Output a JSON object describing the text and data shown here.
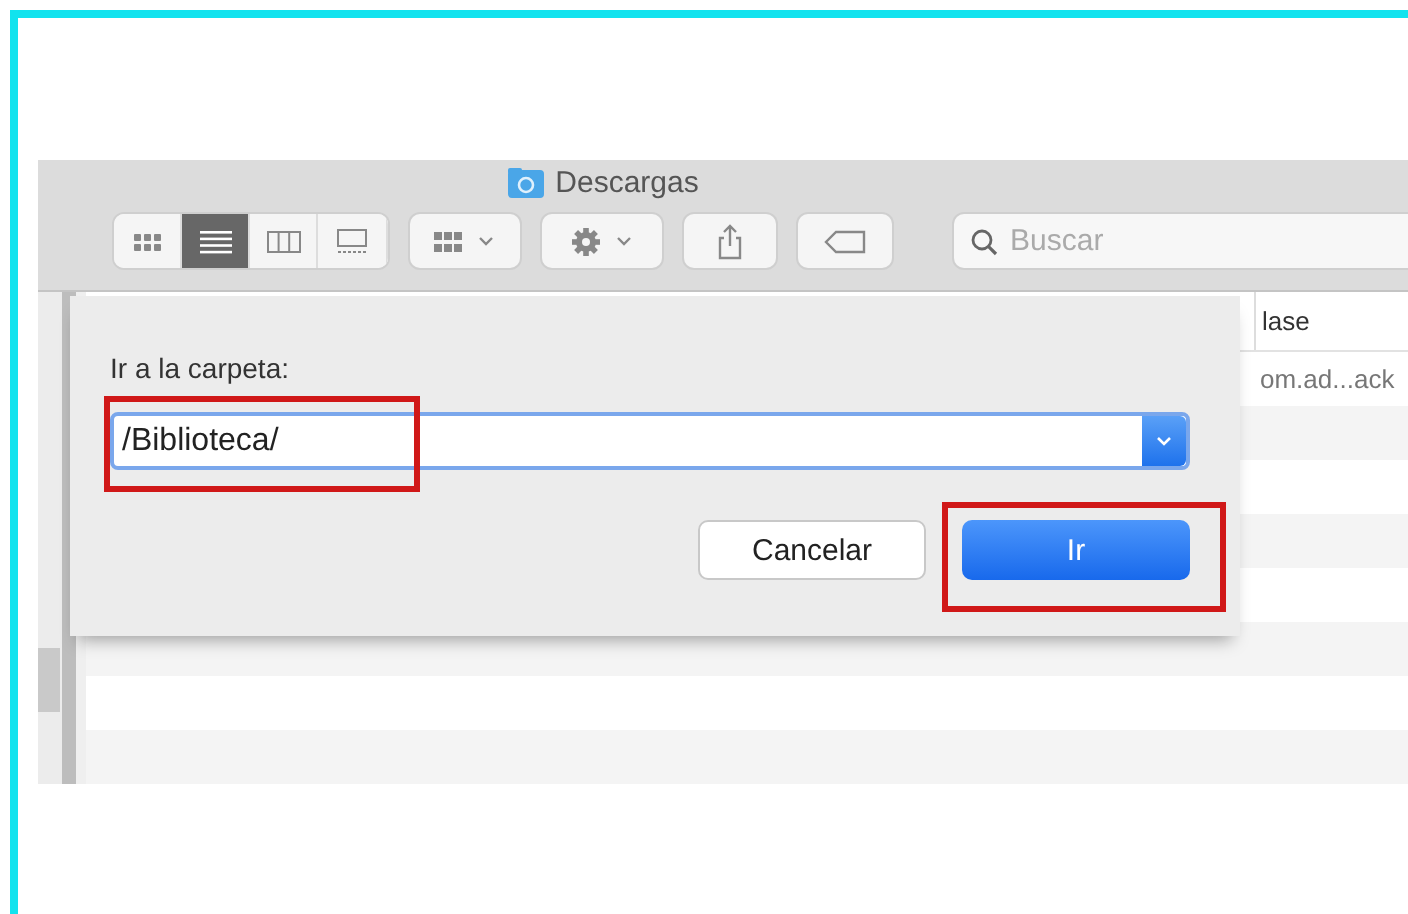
{
  "window": {
    "title": "Descargas"
  },
  "toolbar": {
    "view_buttons": [
      {
        "selected": false
      },
      {
        "selected": true
      },
      {
        "selected": false
      },
      {
        "selected": false
      }
    ],
    "search": {
      "placeholder": "Buscar"
    }
  },
  "list": {
    "columns": [
      "lase"
    ],
    "rows": [
      [
        "om.ad...ack"
      ]
    ]
  },
  "dialog": {
    "label": "Ir a la carpeta:",
    "field": {
      "value": "/Biblioteca/",
      "highlighted": true
    },
    "buttons": [
      {
        "label": "Cancelar",
        "kind": "default",
        "highlighted": false
      },
      {
        "label": "Ir",
        "kind": "primary",
        "highlighted": true
      }
    ]
  }
}
